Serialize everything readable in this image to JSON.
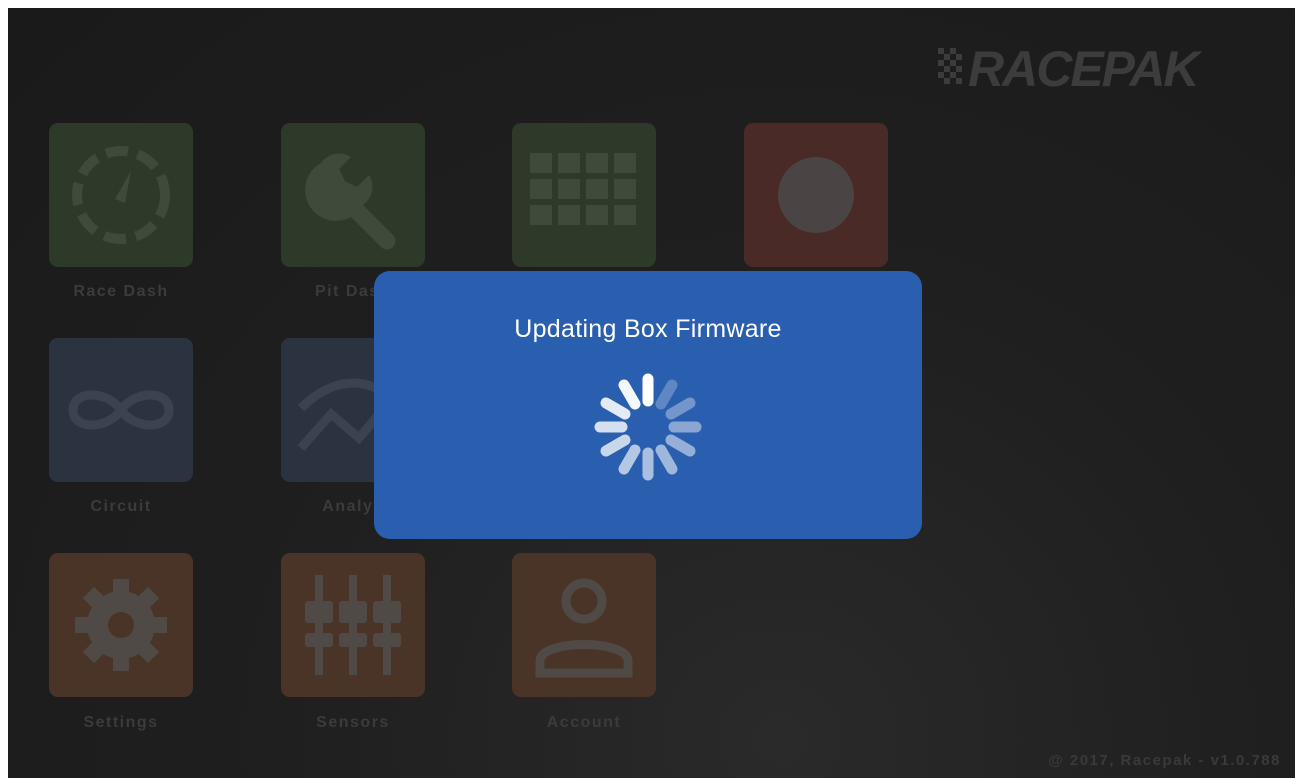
{
  "brand": {
    "logo_text": "RACEPAK"
  },
  "tiles": [
    {
      "id": "race-dash",
      "label": "Race Dash",
      "color": "green",
      "icon": "gauge-icon"
    },
    {
      "id": "pit-dash",
      "label": "Pit Dash",
      "color": "green",
      "icon": "wrench-icon"
    },
    {
      "id": "grid",
      "label": "",
      "color": "green",
      "icon": "grid-icon"
    },
    {
      "id": "record",
      "label": "",
      "color": "red",
      "icon": "record-icon"
    },
    {
      "id": "circuit",
      "label": "Circuit",
      "color": "blue",
      "icon": "infinity-icon"
    },
    {
      "id": "analysis",
      "label": "Analys",
      "color": "blue",
      "icon": "graph-icon"
    },
    {
      "id": "settings",
      "label": "Settings",
      "color": "orange",
      "icon": "gear-icon"
    },
    {
      "id": "sensors",
      "label": "Sensors",
      "color": "orange",
      "icon": "sliders-icon"
    },
    {
      "id": "account",
      "label": "Account",
      "color": "orange",
      "icon": "user-icon"
    }
  ],
  "footer": {
    "text": "@ 2017, Racepak - v1.0.788"
  },
  "modal": {
    "title": "Updating Box Firmware",
    "icon": "loading-spinner-icon"
  },
  "colors": {
    "modal_bg": "#2a5fb0",
    "green_tile": "#2d3a2a",
    "red_tile": "#4a2a26",
    "blue_tile": "#2c3340",
    "orange_tile": "#4a3427"
  }
}
